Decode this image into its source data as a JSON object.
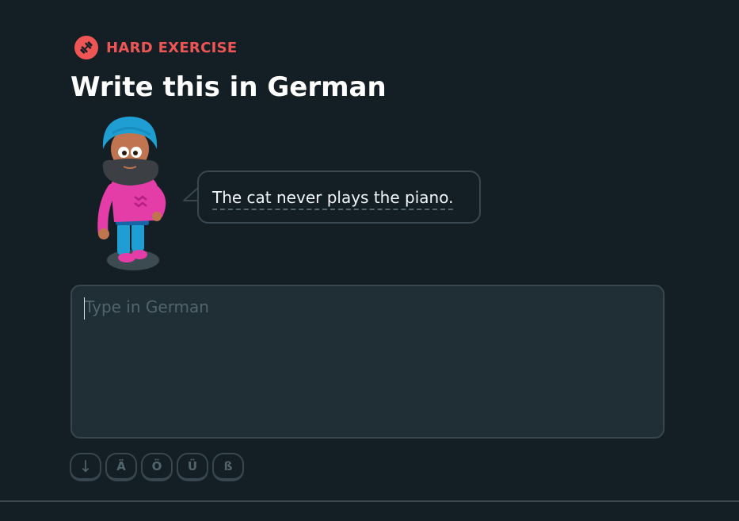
{
  "challenge": {
    "badge_label": "HARD EXERCISE",
    "badge_icon": "dumbbell-icon",
    "title": "Write this in German",
    "prompt": "The cat never plays the piano."
  },
  "answer": {
    "placeholder": "Type in German",
    "value": ""
  },
  "special_keys": {
    "toggle": "↓",
    "a_umlaut": "Ä",
    "o_umlaut": "Ö",
    "u_umlaut": "Ü",
    "eszett": "ß"
  },
  "colors": {
    "background": "#131f24",
    "accent_red": "#ee5555",
    "border": "#37464f",
    "input_bg": "#202f36",
    "muted_text": "#52656d"
  }
}
